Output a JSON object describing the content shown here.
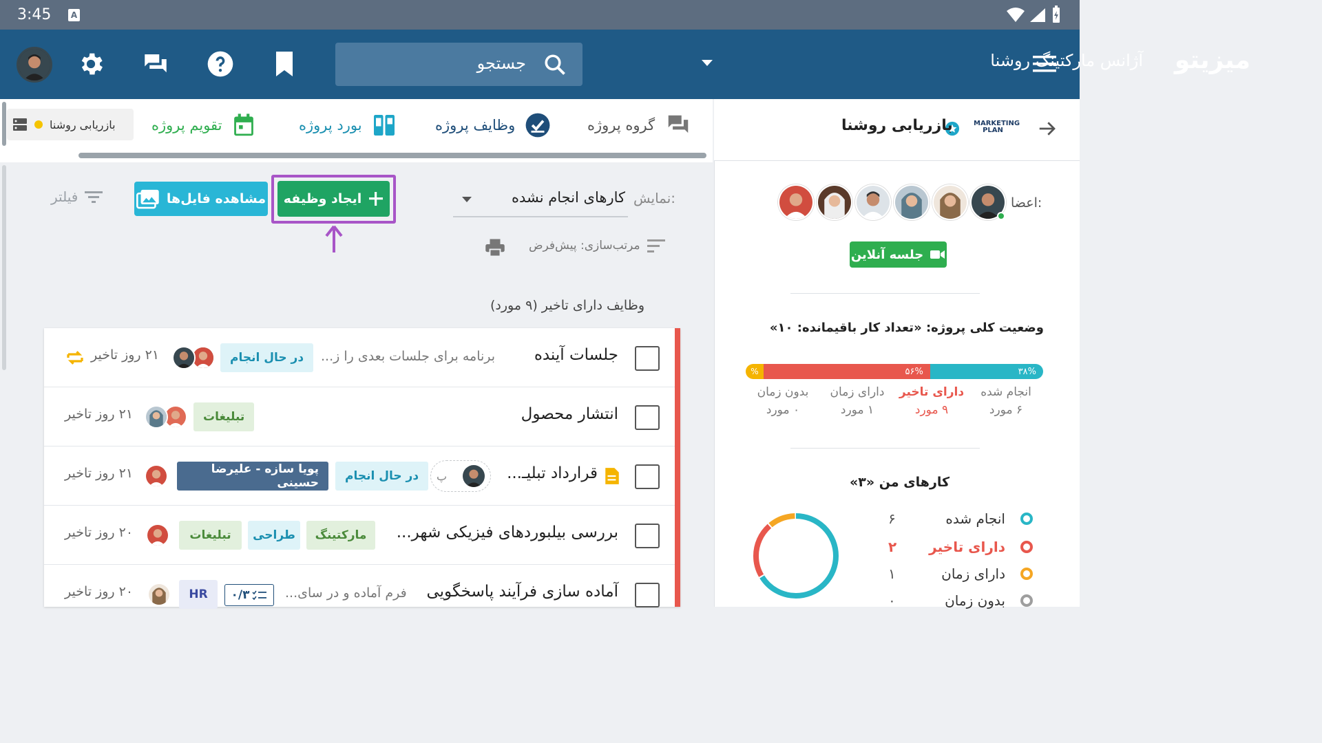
{
  "status_bar": {
    "time": "3:45",
    "sim_icon": "A"
  },
  "app_bar": {
    "brand": "میزیتو",
    "org_name": "آژانس مارکتینگ روشنا",
    "search_placeholder": "جستجو"
  },
  "tabs": {
    "group": "گروه پروژه",
    "tasks": "وظایف پروژه",
    "board": "بورد پروژه",
    "calendar": "تقویم پروژه",
    "review_chip": "بازریابی روشنا"
  },
  "toolbar": {
    "filter_label": "فیلتر",
    "files_button": "مشاهده فایل‌ها",
    "create_task_button": "ایجاد وظیفه",
    "show_label": "نمایش:",
    "show_value": "کارهای انجام نشده",
    "sort_label": "مرتب‌سازی: پیش‌فرض"
  },
  "section_title": "وظایف دارای تاخیر (۹ مورد)",
  "tasks": [
    {
      "title": "جلسات آینده",
      "desc": "برنامه برای جلسات بعدی را ز...",
      "chips": [
        "در حال انجام"
      ],
      "delay": "۲۱ روز تاخیر"
    },
    {
      "title": "انتشار محصول",
      "desc": "",
      "chips": [
        "تبلیغات"
      ],
      "delay": "۲۱ روز تاخیر"
    },
    {
      "title": "قرارداد تبلیـ...",
      "desc": "",
      "chips": [
        "در حال انجام",
        "پویا سازه - علیرضا حسینی"
      ],
      "chat_chip": "پ",
      "delay": "۲۱ روز تاخیر"
    },
    {
      "title": "بررسی بیلبوردهای فیزیکی شهر...",
      "desc": "",
      "chips": [
        "مارکتینگ",
        "طراحی",
        "تبلیغات"
      ],
      "delay": "۲۰ روز تاخیر"
    },
    {
      "title": "آماده سازی فرآیند پاسخگویی",
      "desc": "فرم آماده و در سای...",
      "chips": [
        "۰/۳",
        "HR"
      ],
      "delay": "۲۰ روز تاخیر"
    }
  ],
  "right_panel": {
    "project_name": "بازریابی روشنا",
    "logo_text": "MARKETING PLAN",
    "members_label": "اعضا:",
    "online_meeting": "جلسه آنلاین",
    "status_title": "وضعیت کلی پروژه: «تعداد کار باقیمانده: ۱۰»",
    "progress": {
      "done_pct": 38,
      "late_pct": 56,
      "ontime_pct": 6,
      "done_label": "۳۸%",
      "late_label": "۵۶%",
      "ontime_label": "%"
    },
    "stats": [
      {
        "label": "انجام شده",
        "count": "۶ مورد",
        "color": "#7a7a7a"
      },
      {
        "label": "دارای تاخیر",
        "count": "۹ مورد",
        "color": "#e8574d"
      },
      {
        "label": "دارای زمان",
        "count": "۱ مورد",
        "color": "#7a7a7a"
      },
      {
        "label": "بدون زمان",
        "count": "۰ مورد",
        "color": "#7a7a7a"
      }
    ],
    "my_tasks_title": "کارهای من «۳»",
    "legend": [
      {
        "label": "انجام شده",
        "value": "۶",
        "color": "#29b6c6"
      },
      {
        "label": "دارای تاخیر",
        "value": "۲",
        "color": "#e8574d"
      },
      {
        "label": "دارای زمان",
        "value": "۱",
        "color": "#f5a623"
      },
      {
        "label": "بدون زمان",
        "value": "۰",
        "color": "#9e9e9e"
      }
    ]
  },
  "colors": {
    "appbar": "#1f5a86",
    "statusbar": "#5d6d80",
    "green": "#1fa463",
    "cyan": "#29b6c6",
    "red": "#e8574d",
    "purple": "#a855c7"
  }
}
